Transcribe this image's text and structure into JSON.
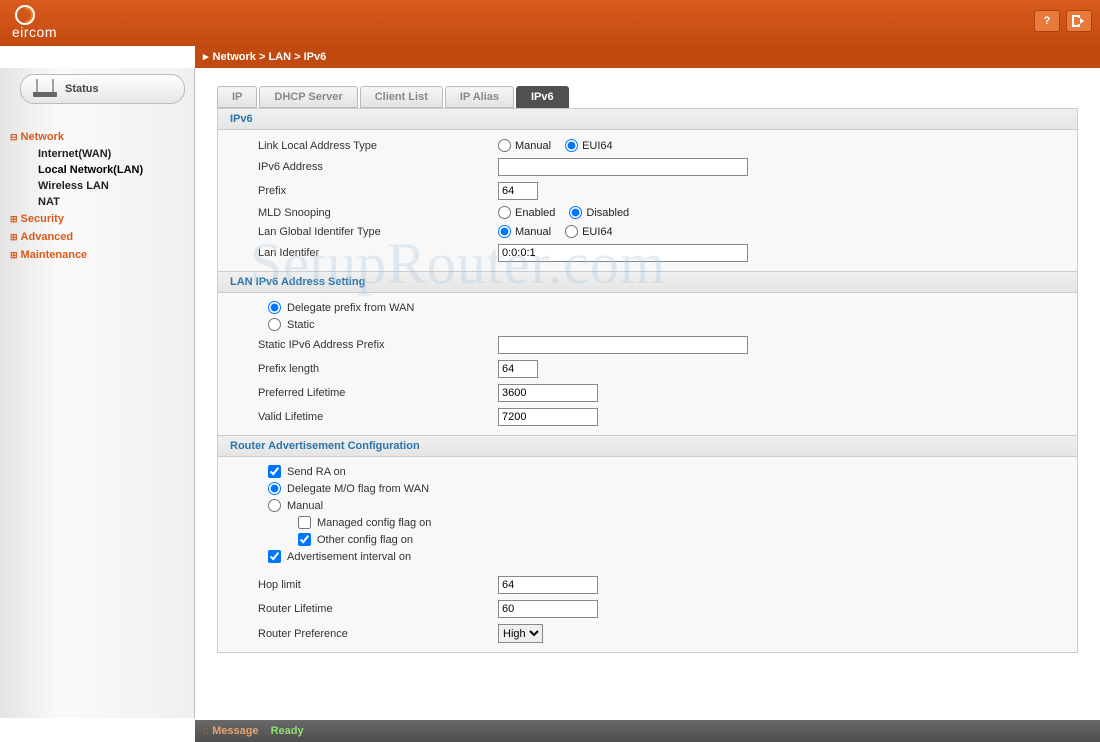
{
  "brand": "eircom",
  "breadcrumb": "Network > LAN > IPv6",
  "status_tab": "Status",
  "nav": {
    "network": "Network",
    "internet_wan": "Internet(WAN)",
    "local_network_lan": "Local Network(LAN)",
    "wireless_lan": "Wireless LAN",
    "nat": "NAT",
    "security": "Security",
    "advanced": "Advanced",
    "maintenance": "Maintenance"
  },
  "tabs": {
    "ip": "IP",
    "dhcp": "DHCP Server",
    "client": "Client List",
    "alias": "IP Alias",
    "ipv6": "IPv6"
  },
  "groups": {
    "ipv6": "IPv6",
    "lan_setting": "LAN IPv6 Address Setting",
    "ra_config": "Router Advertisement Configuration"
  },
  "labels": {
    "link_local_type": "Link Local Address Type",
    "ipv6_addr": "IPv6 Address",
    "prefix": "Prefix",
    "mld_snooping": "MLD Snooping",
    "lan_global_id_type": "Lan Global Identifer Type",
    "lan_identifier": "Lan Identifer",
    "delegate_prefix": "Delegate prefix from WAN",
    "static": "Static",
    "static_prefix": "Static IPv6 Address Prefix",
    "prefix_length": "Prefix length",
    "preferred_lifetime": "Preferred Lifetime",
    "valid_lifetime": "Valid Lifetime",
    "send_ra": "Send RA on",
    "delegate_mo": "Delegate M/O flag from WAN",
    "manual": "Manual",
    "managed_flag": "Managed config flag on",
    "other_flag": "Other config flag on",
    "adv_interval": "Advertisement interval on",
    "hop_limit": "Hop limit",
    "router_lifetime": "Router Lifetime",
    "router_pref": "Router Preference"
  },
  "radio": {
    "manual": "Manual",
    "eui64": "EUI64",
    "enabled": "Enabled",
    "disabled": "Disabled"
  },
  "values": {
    "ipv6_addr": "",
    "prefix": "64",
    "lan_identifier": "0:0:0:1",
    "static_prefix": "",
    "prefix_length": "64",
    "preferred_lifetime": "3600",
    "valid_lifetime": "7200",
    "hop_limit": "64",
    "router_lifetime": "60",
    "router_pref": "High"
  },
  "statusbar": {
    "label": "Message",
    "value": "Ready"
  },
  "watermark": "SetupRouter.com"
}
